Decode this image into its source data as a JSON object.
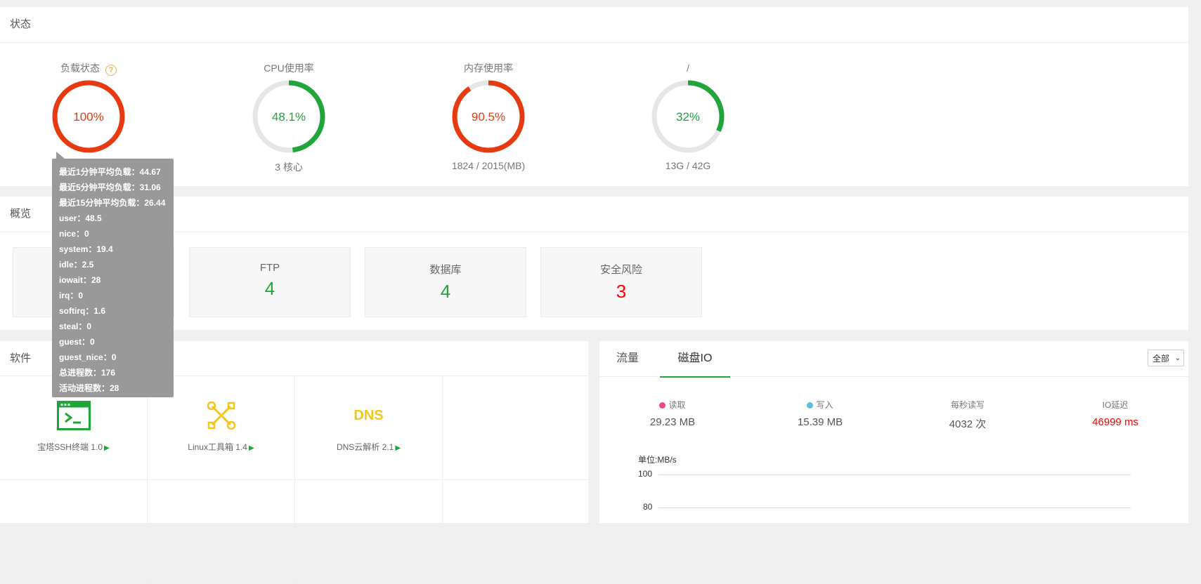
{
  "status": {
    "title": "状态",
    "load": {
      "label": "负载状态",
      "help": "?",
      "value": "100%",
      "percent": 100,
      "color": "#e83a10"
    },
    "cpu": {
      "label": "CPU使用率",
      "value": "48.1%",
      "percent": 48.1,
      "sub": "3 核心",
      "color": "#20a53a"
    },
    "mem": {
      "label": "内存使用率",
      "value": "90.5%",
      "percent": 90.5,
      "sub": "1824 / 2015(MB)",
      "color": "#e83a10"
    },
    "disk": {
      "label": "/",
      "value": "32%",
      "percent": 32,
      "sub": "13G / 42G",
      "color": "#20a53a"
    }
  },
  "tooltip": {
    "lines": [
      "最近1分钟平均负载：44.67",
      "最近5分钟平均负载：31.06",
      "最近15分钟平均负载：26.44",
      "user：48.5",
      "nice：0",
      "system：19.4",
      "idle：2.5",
      "iowait：28",
      "irq：0",
      "softirq：1.6",
      "steal：0",
      "guest：0",
      "guest_nice：0",
      "总进程数：176",
      "活动进程数：28"
    ]
  },
  "overview": {
    "title": "概览",
    "cards": [
      {
        "label": "FTP",
        "value": "4",
        "color": "#20a53a"
      },
      {
        "label": "数据库",
        "value": "4",
        "color": "#20a53a"
      },
      {
        "label": "安全风险",
        "value": "3",
        "color": "#ff0000"
      }
    ]
  },
  "software": {
    "title": "软件",
    "items": [
      {
        "name": "宝塔SSH终端 1.0",
        "icon": "terminal-icon"
      },
      {
        "name": "Linux工具箱 1.4",
        "icon": "tools-icon"
      },
      {
        "name": "DNS云解析 2.1",
        "icon": "dns-icon",
        "icon_text": "DNS"
      }
    ],
    "play": "▶"
  },
  "traffic": {
    "tabs": [
      "流量",
      "磁盘IO"
    ],
    "active_tab": 1,
    "select_value": "全部",
    "stats": [
      {
        "label": "读取",
        "value": "29.23 MB",
        "dot": "#f04a7b"
      },
      {
        "label": "写入",
        "value": "15.39 MB",
        "dot": "#5bc0de"
      },
      {
        "label": "每秒读写",
        "value": "4032 次"
      },
      {
        "label": "IO延迟",
        "value": "46999 ms",
        "value_color": "#ff0000"
      }
    ],
    "chart_data": {
      "type": "line",
      "ylabel": "单位:MB/s",
      "y_ticks": [
        "100",
        "80"
      ],
      "series": []
    }
  }
}
